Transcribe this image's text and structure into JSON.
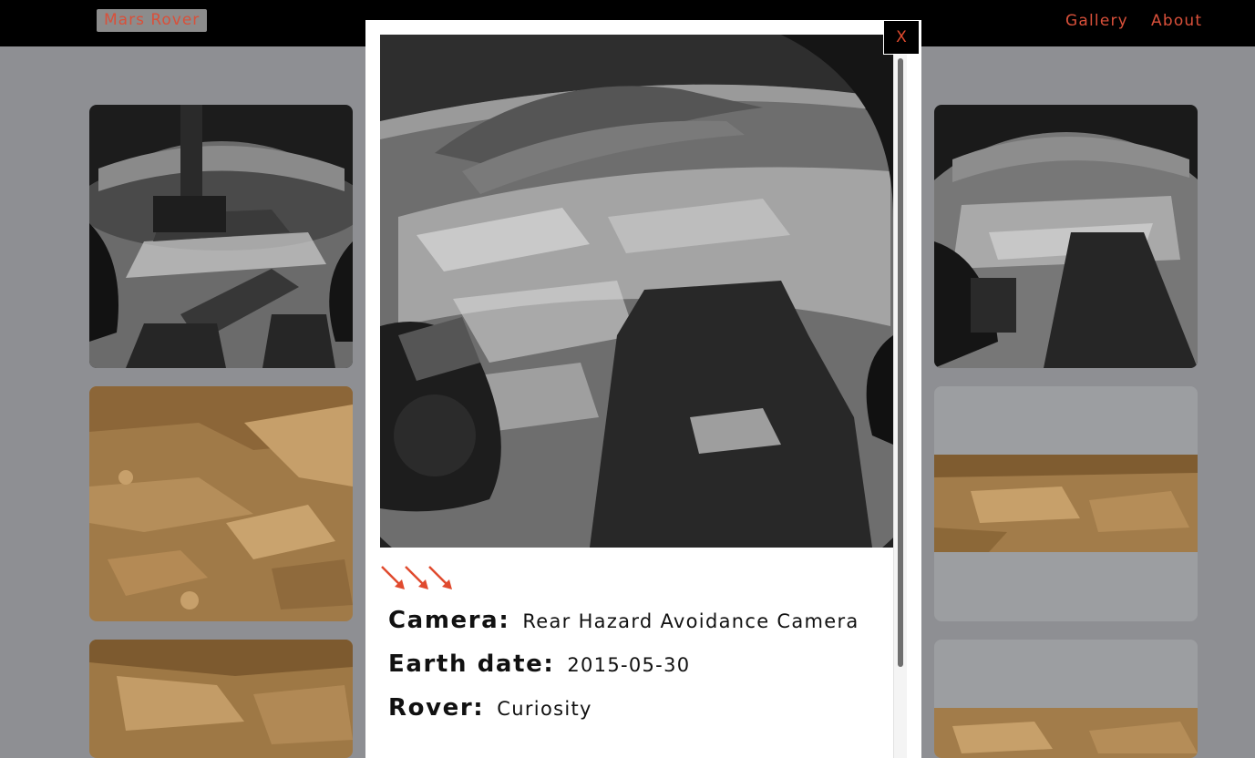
{
  "header": {
    "brand": "Mars Rover",
    "nav": {
      "gallery": "Gallery",
      "about": "About"
    }
  },
  "colors": {
    "accent": "#d9503a",
    "header_bg": "#000000",
    "overlay": "#8e8f93"
  },
  "gallery": {
    "thumbnails": [
      {
        "kind": "grayscale hazcam photo"
      },
      {
        "kind": "color mastcam photo"
      },
      {
        "kind": "color mastcam photo"
      },
      {
        "kind": "grayscale hazcam photo"
      },
      {
        "kind": "color mastcam panorama strip"
      },
      {
        "kind": "color mastcam panorama strip"
      }
    ]
  },
  "modal": {
    "close_label": "X",
    "arrows_icon": "triple-arrow-icon",
    "camera_label": "Camera:",
    "camera_value": "Rear Hazard Avoidance Camera",
    "date_label": "Earth date:",
    "date_value": "2015-05-30",
    "rover_label": "Rover:",
    "rover_value": "Curiosity"
  }
}
